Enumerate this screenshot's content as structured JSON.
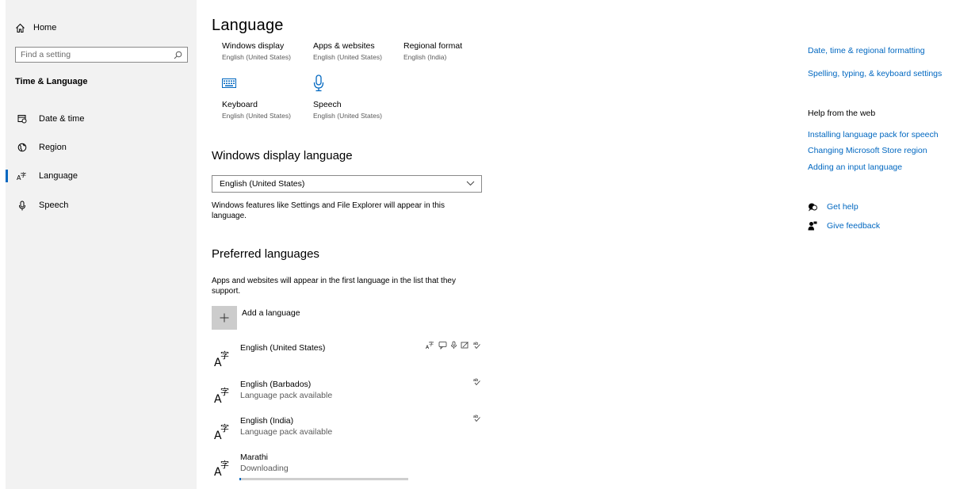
{
  "sidebar": {
    "home_label": "Home",
    "search_placeholder": "Find a setting",
    "section_title": "Time & Language",
    "items": [
      {
        "label": "Date & time"
      },
      {
        "label": "Region"
      },
      {
        "label": "Language"
      },
      {
        "label": "Speech"
      }
    ],
    "active_item": "Language"
  },
  "main": {
    "title": "Language",
    "tiles": [
      {
        "title": "Windows display",
        "sub": "English (United States)"
      },
      {
        "title": "Apps & websites",
        "sub": "English (United States)"
      },
      {
        "title": "Regional format",
        "sub": "English (India)"
      },
      {
        "title": "Keyboard",
        "sub": "English (United States)"
      },
      {
        "title": "Speech",
        "sub": "English (United States)"
      }
    ],
    "display_language": {
      "heading": "Windows display language",
      "selected": "English (United States)",
      "description": "Windows features like Settings and File Explorer will appear in this language."
    },
    "preferred": {
      "heading": "Preferred languages",
      "description": "Apps and websites will appear in the first language in the list that they support.",
      "add_label": "Add a language",
      "languages": [
        {
          "name": "English (United States)",
          "sub": ""
        },
        {
          "name": "English (Barbados)",
          "sub": "Language pack available"
        },
        {
          "name": "English (India)",
          "sub": "Language pack available"
        },
        {
          "name": "Marathi",
          "sub": "Downloading",
          "progress": 0.01
        }
      ]
    }
  },
  "right": {
    "links": [
      "Date, time & regional formatting",
      "Spelling, typing, & keyboard settings"
    ],
    "help_heading": "Help from the web",
    "help_links": [
      "Installing language pack for speech",
      "Changing Microsoft Store region",
      "Adding an input language"
    ],
    "get_help": "Get help",
    "give_feedback": "Give feedback"
  },
  "colors": {
    "accent": "#0067c0",
    "sidebar_bg": "#f2f2f2"
  }
}
